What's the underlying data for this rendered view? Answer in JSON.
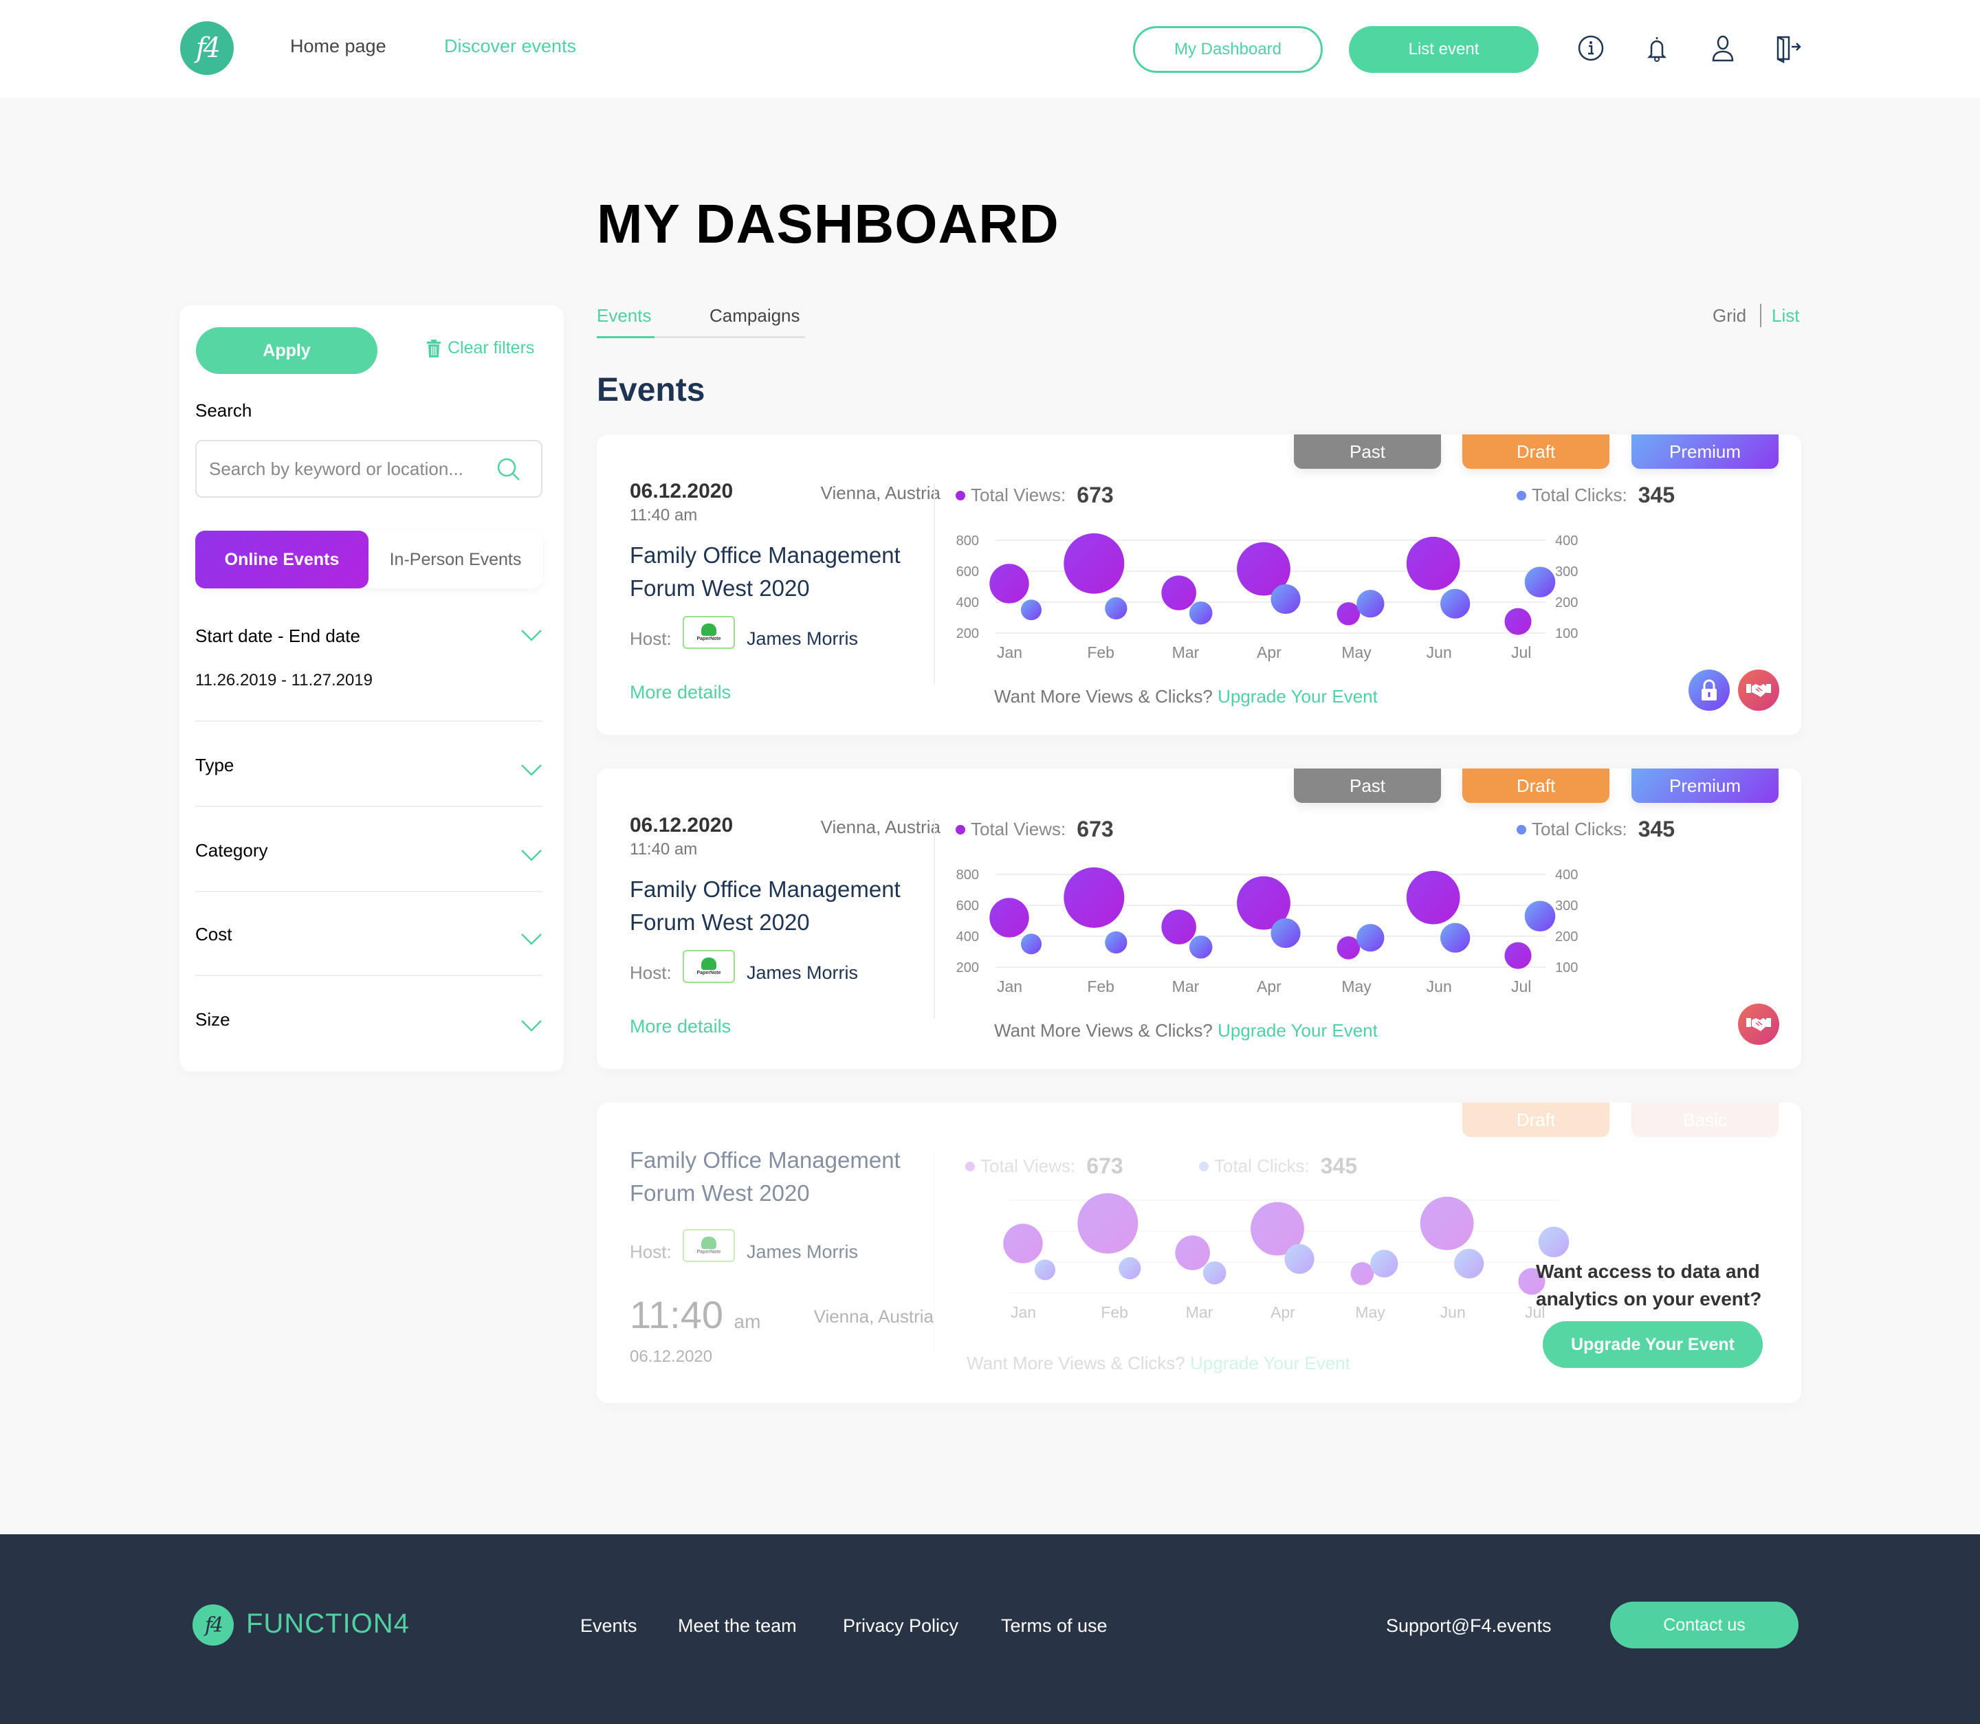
{
  "header": {
    "logo_text": "f4",
    "nav": [
      {
        "label": "Home page",
        "active": false
      },
      {
        "label": "Discover events",
        "active": true
      }
    ],
    "my_dashboard_label": "My Dashboard",
    "list_event_label": "List event",
    "icons": [
      "info-icon",
      "bell-icon",
      "user-icon",
      "logout-icon"
    ]
  },
  "page_title": "MY DASHBOARD",
  "sidebar": {
    "apply_label": "Apply",
    "clear_filters_label": "Clear filters",
    "search_label": "Search",
    "search_placeholder": "Search by keyword or location...",
    "search_value": "",
    "segments": [
      {
        "label": "Online Events",
        "selected": true
      },
      {
        "label": "In-Person Events",
        "selected": false
      }
    ],
    "filters": [
      {
        "label": "Start date - End date",
        "value": "11.26.2019 - 11.27.2019"
      },
      {
        "label": "Type"
      },
      {
        "label": "Category"
      },
      {
        "label": "Cost"
      },
      {
        "label": "Size"
      }
    ]
  },
  "tabs": [
    {
      "label": "Events",
      "active": true
    },
    {
      "label": "Campaigns",
      "active": false
    }
  ],
  "view_toggle": {
    "grid": "Grid",
    "list": "List",
    "active": "List"
  },
  "section_title": "Events",
  "colors": {
    "accent": "#4fd1a1",
    "navy": "#1f3353",
    "views_purple": "#a32be3",
    "clicks_blue": "#6f8cf5",
    "badge_past": "#888888",
    "badge_draft": "#f2994a",
    "badge_premium": "#7a5cf2",
    "footer_bg": "#283445"
  },
  "events": [
    {
      "badges": [
        "Past",
        "Draft",
        "Premium"
      ],
      "date": "06.12.2020",
      "time": "11:40 am",
      "location": "Vienna, Austria",
      "title": "Family Office Management Forum West 2020",
      "host_label": "Host:",
      "host_logo_text": "PaperNote",
      "host_name": "James Morris",
      "more_details": "More details",
      "total_views_label": "Total Views:",
      "total_views": "673",
      "total_clicks_label": "Total Clicks:",
      "total_clicks": "345",
      "upgrade_prompt": "Want More Views & Clicks?",
      "upgrade_link": "Upgrade Your Event",
      "action_icons": [
        "lock-icon",
        "handshake-icon"
      ]
    },
    {
      "badges": [
        "Past",
        "Draft",
        "Premium"
      ],
      "date": "06.12.2020",
      "time": "11:40 am",
      "location": "Vienna, Austria",
      "title": "Family Office Management Forum West 2020",
      "host_label": "Host:",
      "host_logo_text": "PaperNote",
      "host_name": "James Morris",
      "more_details": "More details",
      "total_views_label": "Total Views:",
      "total_views": "673",
      "total_clicks_label": "Total Clicks:",
      "total_clicks": "345",
      "upgrade_prompt": "Want More Views & Clicks?",
      "upgrade_link": "Upgrade Your Event",
      "action_icons": [
        "handshake-icon"
      ]
    },
    {
      "badges": [
        "Draft",
        "Basic"
      ],
      "date": "06.12.2020",
      "time_big": "11:40",
      "time_suffix": "am",
      "location": "Vienna, Austria",
      "title": "Family Office Management Forum West 2020",
      "host_label": "Host:",
      "host_logo_text": "PaperNote",
      "host_name": "James Morris",
      "total_views_label": "Total Views:",
      "total_views": "673",
      "total_clicks_label": "Total Clicks:",
      "total_clicks": "345",
      "upgrade_prompt": "Want More Views & Clicks?",
      "upgrade_link": "Upgrade Your Event",
      "locked_cta_text": "Want access to data and analytics on your event?",
      "locked_cta_button": "Upgrade Your Event"
    }
  ],
  "chart_data": {
    "type": "scatter",
    "subtype": "bubble",
    "categories": [
      "Jan",
      "Feb",
      "Mar",
      "Apr",
      "May",
      "Jun",
      "Jul"
    ],
    "series": [
      {
        "name": "Total Views",
        "axis": "left",
        "values": [
          520,
          650,
          460,
          615,
          325,
          650,
          275
        ],
        "relative_size": [
          0.55,
          1.0,
          0.45,
          0.85,
          0.2,
          0.85,
          0.28
        ]
      },
      {
        "name": "Total Clicks",
        "axis": "right",
        "values": [
          175,
          180,
          165,
          210,
          195,
          195,
          265
        ],
        "relative_size": [
          0.32,
          0.37,
          0.4,
          0.62,
          0.55,
          0.62,
          0.65
        ]
      }
    ],
    "left_axis": {
      "ticks": [
        200,
        400,
        600,
        800
      ],
      "range": [
        200,
        800
      ]
    },
    "right_axis": {
      "ticks": [
        100,
        200,
        300,
        400
      ],
      "range": [
        100,
        400
      ]
    },
    "grid": true,
    "legend": "top"
  },
  "footer": {
    "brand": "FUNCTION4",
    "logo_text": "f4",
    "links": [
      "Events",
      "Meet the team",
      "Privacy Policy",
      "Terms of use"
    ],
    "support_email": "Support@F4.events",
    "contact_label": "Contact us"
  }
}
